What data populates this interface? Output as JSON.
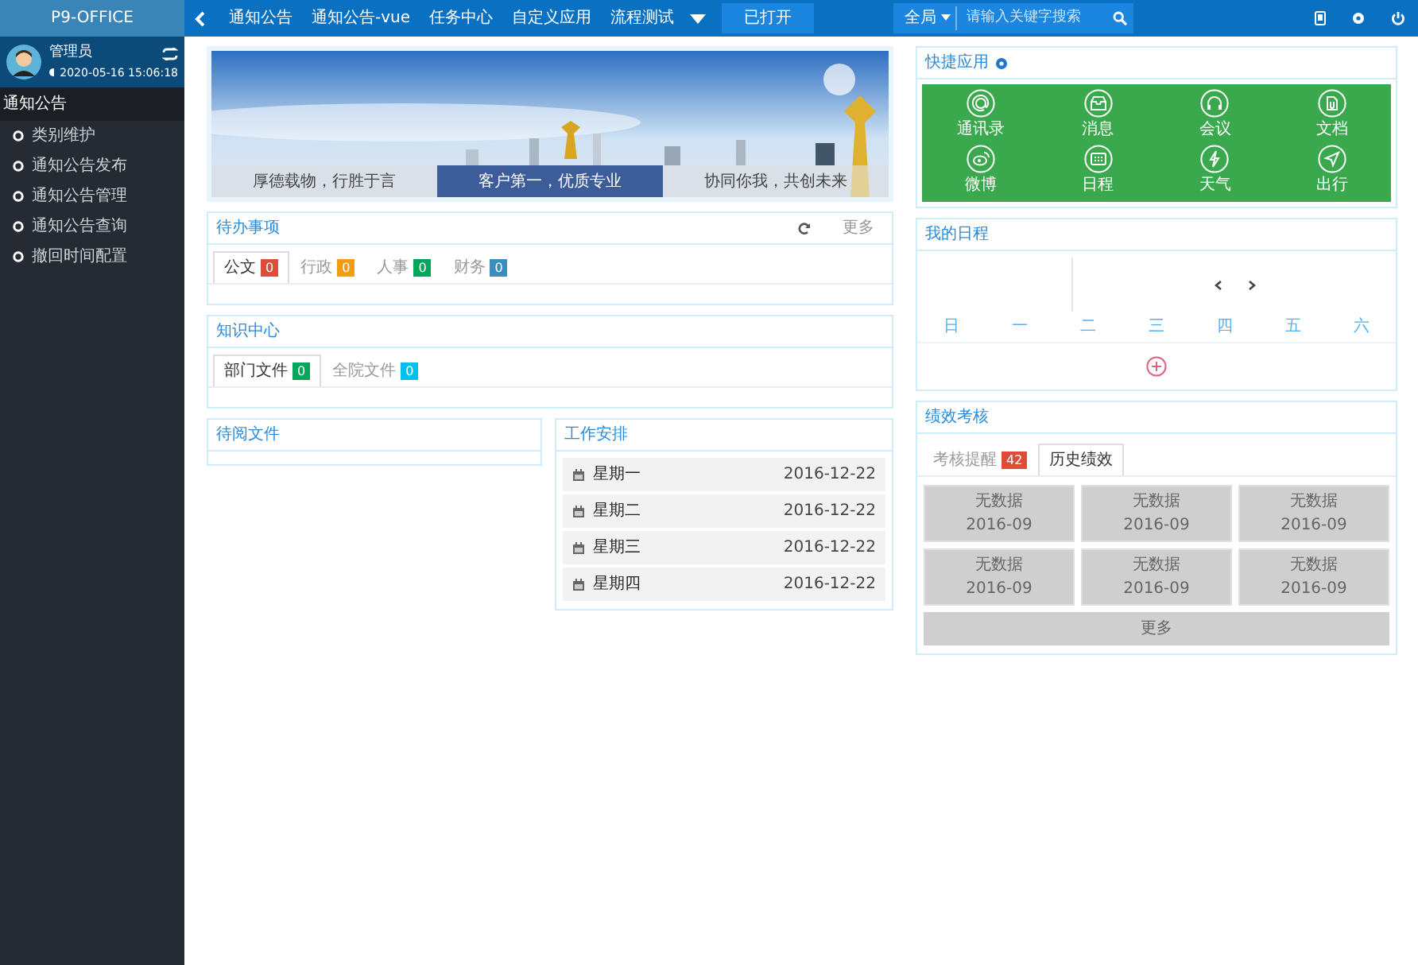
{
  "sidebar": {
    "app_title": "P9-OFFICE",
    "user": {
      "name": "管理员",
      "time": "2020-05-16 15:06:18"
    },
    "menu_title": "通知公告",
    "items": [
      {
        "label": "类别维护"
      },
      {
        "label": "通知公告发布"
      },
      {
        "label": "通知公告管理"
      },
      {
        "label": "通知公告查询"
      },
      {
        "label": "撤回时间配置"
      }
    ]
  },
  "topbar": {
    "nav_items": [
      {
        "label": "通知公告"
      },
      {
        "label": "通知公告-vue"
      },
      {
        "label": "任务中心"
      },
      {
        "label": "自定义应用"
      },
      {
        "label": "流程测试"
      }
    ],
    "opened_button": "已打开",
    "search": {
      "scope": "全局",
      "placeholder": "请输入关键字搜索"
    }
  },
  "banner": {
    "captions": [
      {
        "label": "厚德载物，行胜于言",
        "selected": false
      },
      {
        "label": "客户第一，优质专业",
        "selected": true
      },
      {
        "label": "协同你我，共创未来",
        "selected": false
      }
    ]
  },
  "todo": {
    "title": "待办事项",
    "more": "更多",
    "tabs": [
      {
        "label": "公文",
        "count": "0",
        "color": "#dd4b39",
        "selected": true
      },
      {
        "label": "行政",
        "count": "0",
        "color": "#f39c12",
        "selected": false
      },
      {
        "label": "人事",
        "count": "0",
        "color": "#00a65a",
        "selected": false
      },
      {
        "label": "财务",
        "count": "0",
        "color": "#3c8dbc",
        "selected": false
      }
    ]
  },
  "knowledge": {
    "title": "知识中心",
    "tabs": [
      {
        "label": "部门文件",
        "count": "0",
        "color": "#00a65a",
        "selected": true
      },
      {
        "label": "全院文件",
        "count": "0",
        "color": "#00c0ef",
        "selected": false
      }
    ]
  },
  "pending_docs": {
    "title": "待阅文件"
  },
  "work_schedule": {
    "title": "工作安排",
    "rows": [
      {
        "day": "星期一",
        "date": "2016-12-22"
      },
      {
        "day": "星期二",
        "date": "2016-12-22"
      },
      {
        "day": "星期三",
        "date": "2016-12-22"
      },
      {
        "day": "星期四",
        "date": "2016-12-22"
      }
    ]
  },
  "quick_apps": {
    "title": "快捷应用",
    "apps": [
      {
        "label": "通讯录",
        "kind": "at"
      },
      {
        "label": "消息",
        "kind": "inbox"
      },
      {
        "label": "会议",
        "kind": "headset"
      },
      {
        "label": "文档",
        "kind": "doc"
      },
      {
        "label": "微博",
        "kind": "weibo"
      },
      {
        "label": "日程",
        "kind": "calendar"
      },
      {
        "label": "天气",
        "kind": "bolt"
      },
      {
        "label": "出行",
        "kind": "send"
      }
    ]
  },
  "my_schedule": {
    "title": "我的日程",
    "weekdays": [
      "日",
      "一",
      "二",
      "三",
      "四",
      "五",
      "六"
    ]
  },
  "performance": {
    "title": "绩效考核",
    "tabs": [
      {
        "label": "考核提醒",
        "count": "42",
        "selected": false
      },
      {
        "label": "历史绩效",
        "selected": true
      }
    ],
    "cells": [
      {
        "label": "无数据",
        "date": "2016-09"
      },
      {
        "label": "无数据",
        "date": "2016-09"
      },
      {
        "label": "无数据",
        "date": "2016-09"
      },
      {
        "label": "无数据",
        "date": "2016-09"
      },
      {
        "label": "无数据",
        "date": "2016-09"
      },
      {
        "label": "无数据",
        "date": "2016-09"
      }
    ],
    "more": "更多"
  }
}
